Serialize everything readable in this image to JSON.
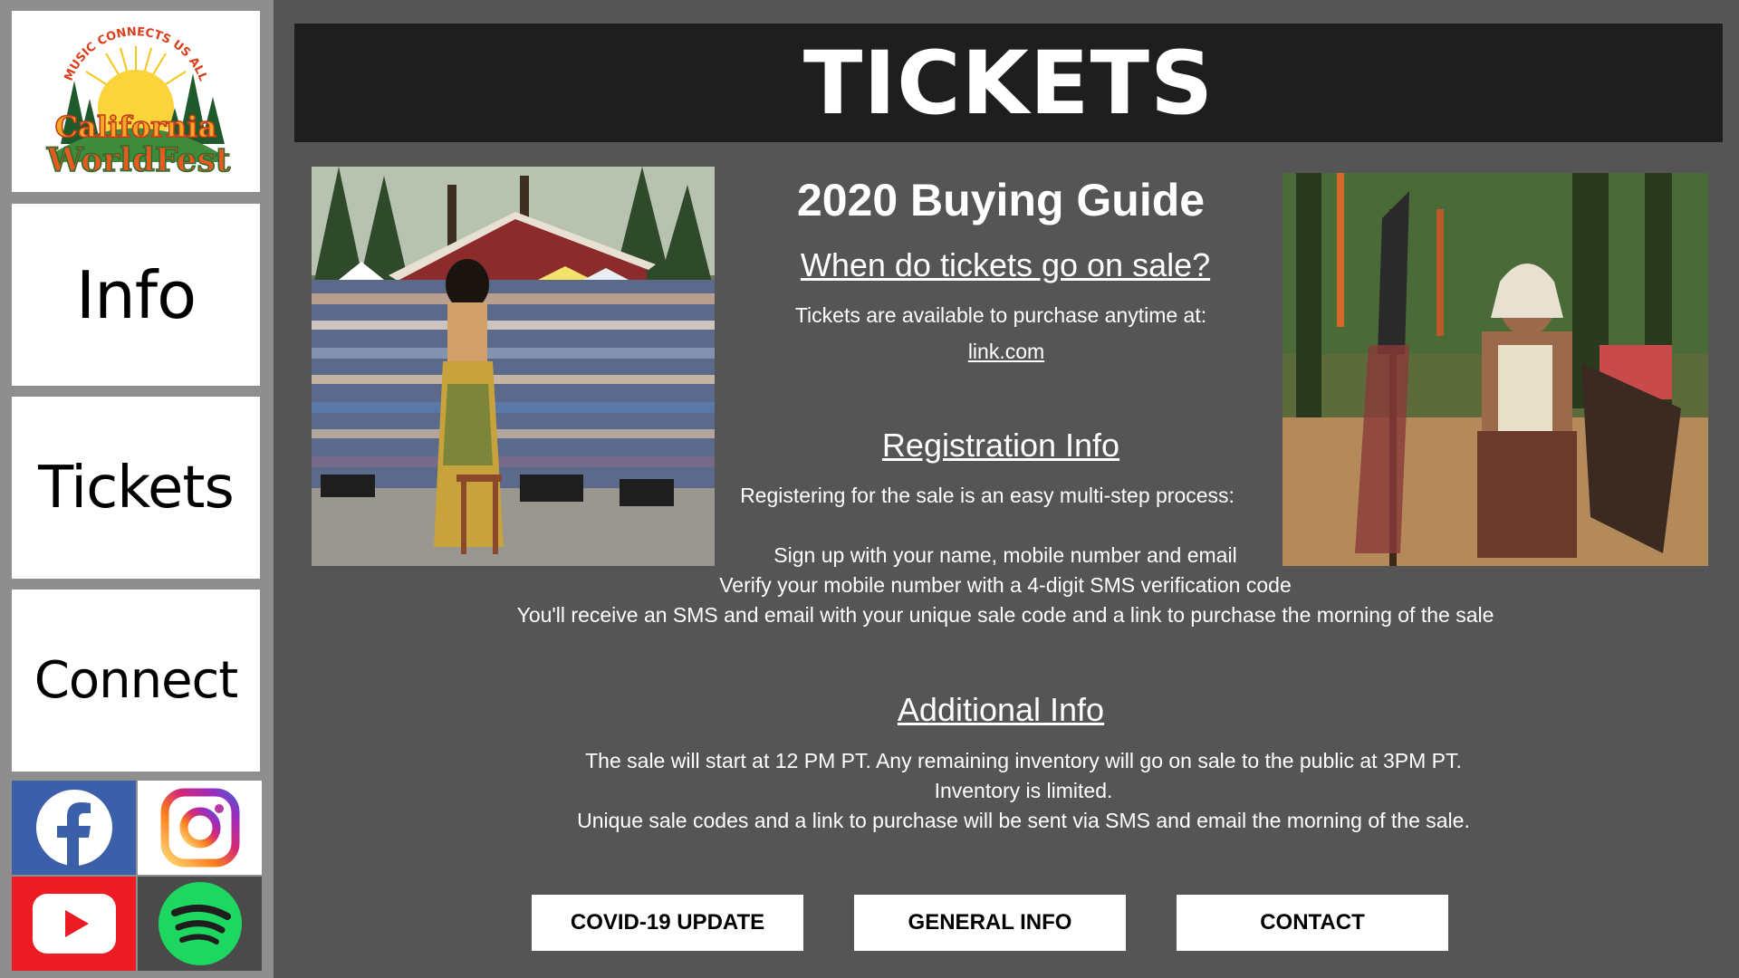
{
  "sidebar": {
    "logo": {
      "arc_text": "MUSIC CONNECTS US ALL",
      "word1": "California",
      "word2": "WorldFest"
    },
    "nav": [
      {
        "label": "Info"
      },
      {
        "label": "Tickets"
      },
      {
        "label": "Connect"
      }
    ],
    "social": [
      {
        "icon": "facebook-icon",
        "color": "#3b5fa8"
      },
      {
        "icon": "instagram-icon",
        "color": "#d6249f"
      },
      {
        "icon": "youtube-icon",
        "color": "#ed1c24"
      },
      {
        "icon": "spotify-icon",
        "color": "#1ed760"
      }
    ]
  },
  "header": {
    "title": "TICKETS"
  },
  "main": {
    "guide_title": "2020 Buying Guide",
    "sale": {
      "heading": "When do tickets go on sale?",
      "text": "Tickets are available to purchase anytime at:",
      "link": "link.com"
    },
    "registration": {
      "heading": "Registration Info",
      "intro": "Registering for the sale is an easy multi-step process:",
      "steps": [
        "Sign up with your name, mobile number and email",
        "Verify your mobile number with a 4-digit SMS verification code",
        "You'll receive an SMS and email with your unique sale code and a link to purchase the morning of the sale"
      ]
    },
    "additional": {
      "heading": "Additional Info",
      "lines": [
        "The sale will start at 12 PM PT.  Any remaining inventory will go on sale to the public at 3PM PT.",
        "Inventory is limited.",
        "Unique sale codes and a link to purchase will be sent via SMS and email the morning of the sale."
      ]
    }
  },
  "buttons": [
    {
      "label": "COVID-19 UPDATE"
    },
    {
      "label": "GENERAL INFO"
    },
    {
      "label": "CONTACT"
    }
  ],
  "colors": {
    "page_bg": "#555555",
    "sidebar_bg": "#8e8e8e",
    "header_bg": "#1e1e1e"
  }
}
